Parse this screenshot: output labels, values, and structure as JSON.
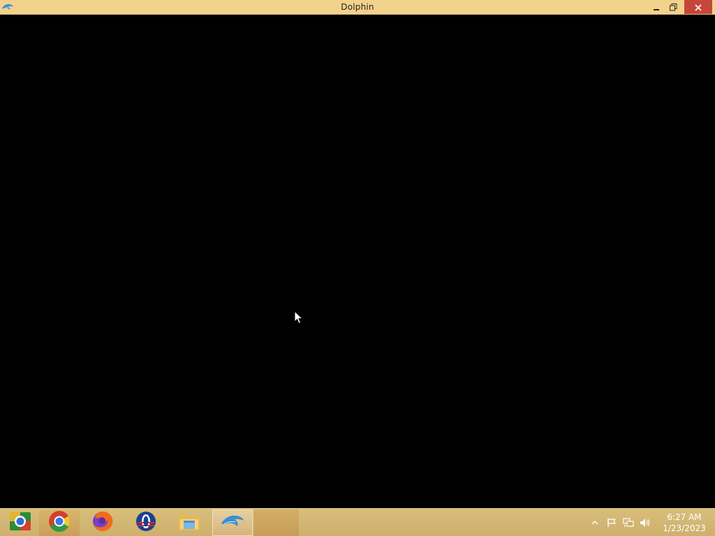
{
  "window": {
    "title": "Dolphin",
    "app_icon": "dolphin-icon",
    "controls": {
      "minimize": "minimize-icon",
      "restore": "restore-icon",
      "close": "close-icon"
    }
  },
  "taskbar": {
    "apps": [
      {
        "name": "Chrome Remote Desktop",
        "icon": "chrome-remote-desktop-icon"
      },
      {
        "name": "Google Chrome",
        "icon": "chrome-icon"
      },
      {
        "name": "Firefox",
        "icon": "firefox-icon"
      },
      {
        "name": "Opera",
        "icon": "opera-icon"
      },
      {
        "name": "File Explorer",
        "icon": "folder-icon"
      },
      {
        "name": "Dolphin",
        "icon": "dolphin-icon",
        "active": true
      }
    ],
    "tray": {
      "icons": [
        "show-hidden-icons-arrow",
        "action-center-flag-icon",
        "network-icon",
        "volume-icon"
      ],
      "time": "6:27 AM",
      "date": "1/23/2023"
    }
  },
  "colors": {
    "titlebar": "#f3d28c",
    "close_button": "#c7463a",
    "taskbar": "#d2b572",
    "content": "#000000"
  }
}
